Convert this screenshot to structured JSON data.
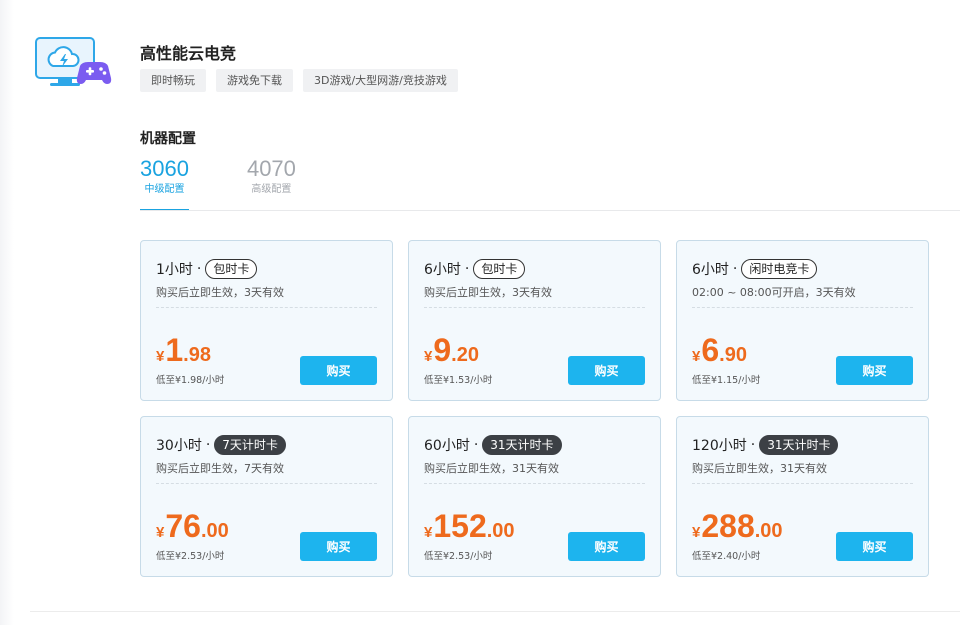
{
  "header": {
    "title": "高性能云电竞",
    "tags": [
      "即时畅玩",
      "游戏免下载",
      "3D游戏/大型网游/竞技游戏"
    ]
  },
  "config": {
    "section_title": "机器配置",
    "tabs": [
      {
        "name": "3060",
        "sub": "中级配置",
        "active": true
      },
      {
        "name": "4070",
        "sub": "高级配置",
        "active": false
      }
    ]
  },
  "colors": {
    "accent": "#1aa3e0",
    "buy_button": "#1db4ee",
    "price": "#ee6a1d",
    "card_bg": "#f3f9fd",
    "dark_badge": "#3c4045"
  },
  "cards": [
    {
      "hours": "1小时",
      "dot": "·",
      "badge": "包时卡",
      "badge_style": "outline",
      "desc": "购买后立即生效，3天有效",
      "currency": "¥",
      "price_int": "1",
      "price_dec": ".98",
      "unit": "低至¥1.98/小时",
      "button": "购买"
    },
    {
      "hours": "6小时",
      "dot": "·",
      "badge": "包时卡",
      "badge_style": "outline",
      "desc": "购买后立即生效，3天有效",
      "currency": "¥",
      "price_int": "9",
      "price_dec": ".20",
      "unit": "低至¥1.53/小时",
      "button": "购买"
    },
    {
      "hours": "6小时",
      "dot": "·",
      "badge": "闲时电竞卡",
      "badge_style": "outline",
      "desc": "02:00 ~ 08:00可开启，3天有效",
      "currency": "¥",
      "price_int": "6",
      "price_dec": ".90",
      "unit": "低至¥1.15/小时",
      "button": "购买"
    },
    {
      "hours": "30小时",
      "dot": "·",
      "badge": "7天计时卡",
      "badge_style": "dark",
      "desc": "购买后立即生效，7天有效",
      "currency": "¥",
      "price_int": "76",
      "price_dec": ".00",
      "unit": "低至¥2.53/小时",
      "button": "购买"
    },
    {
      "hours": "60小时",
      "dot": "·",
      "badge": "31天计时卡",
      "badge_style": "dark",
      "desc": "购买后立即生效，31天有效",
      "currency": "¥",
      "price_int": "152",
      "price_dec": ".00",
      "unit": "低至¥2.53/小时",
      "button": "购买"
    },
    {
      "hours": "120小时",
      "dot": "·",
      "badge": "31天计时卡",
      "badge_style": "dark",
      "desc": "购买后立即生效，31天有效",
      "currency": "¥",
      "price_int": "288",
      "price_dec": ".00",
      "unit": "低至¥2.40/小时",
      "button": "购买"
    }
  ]
}
